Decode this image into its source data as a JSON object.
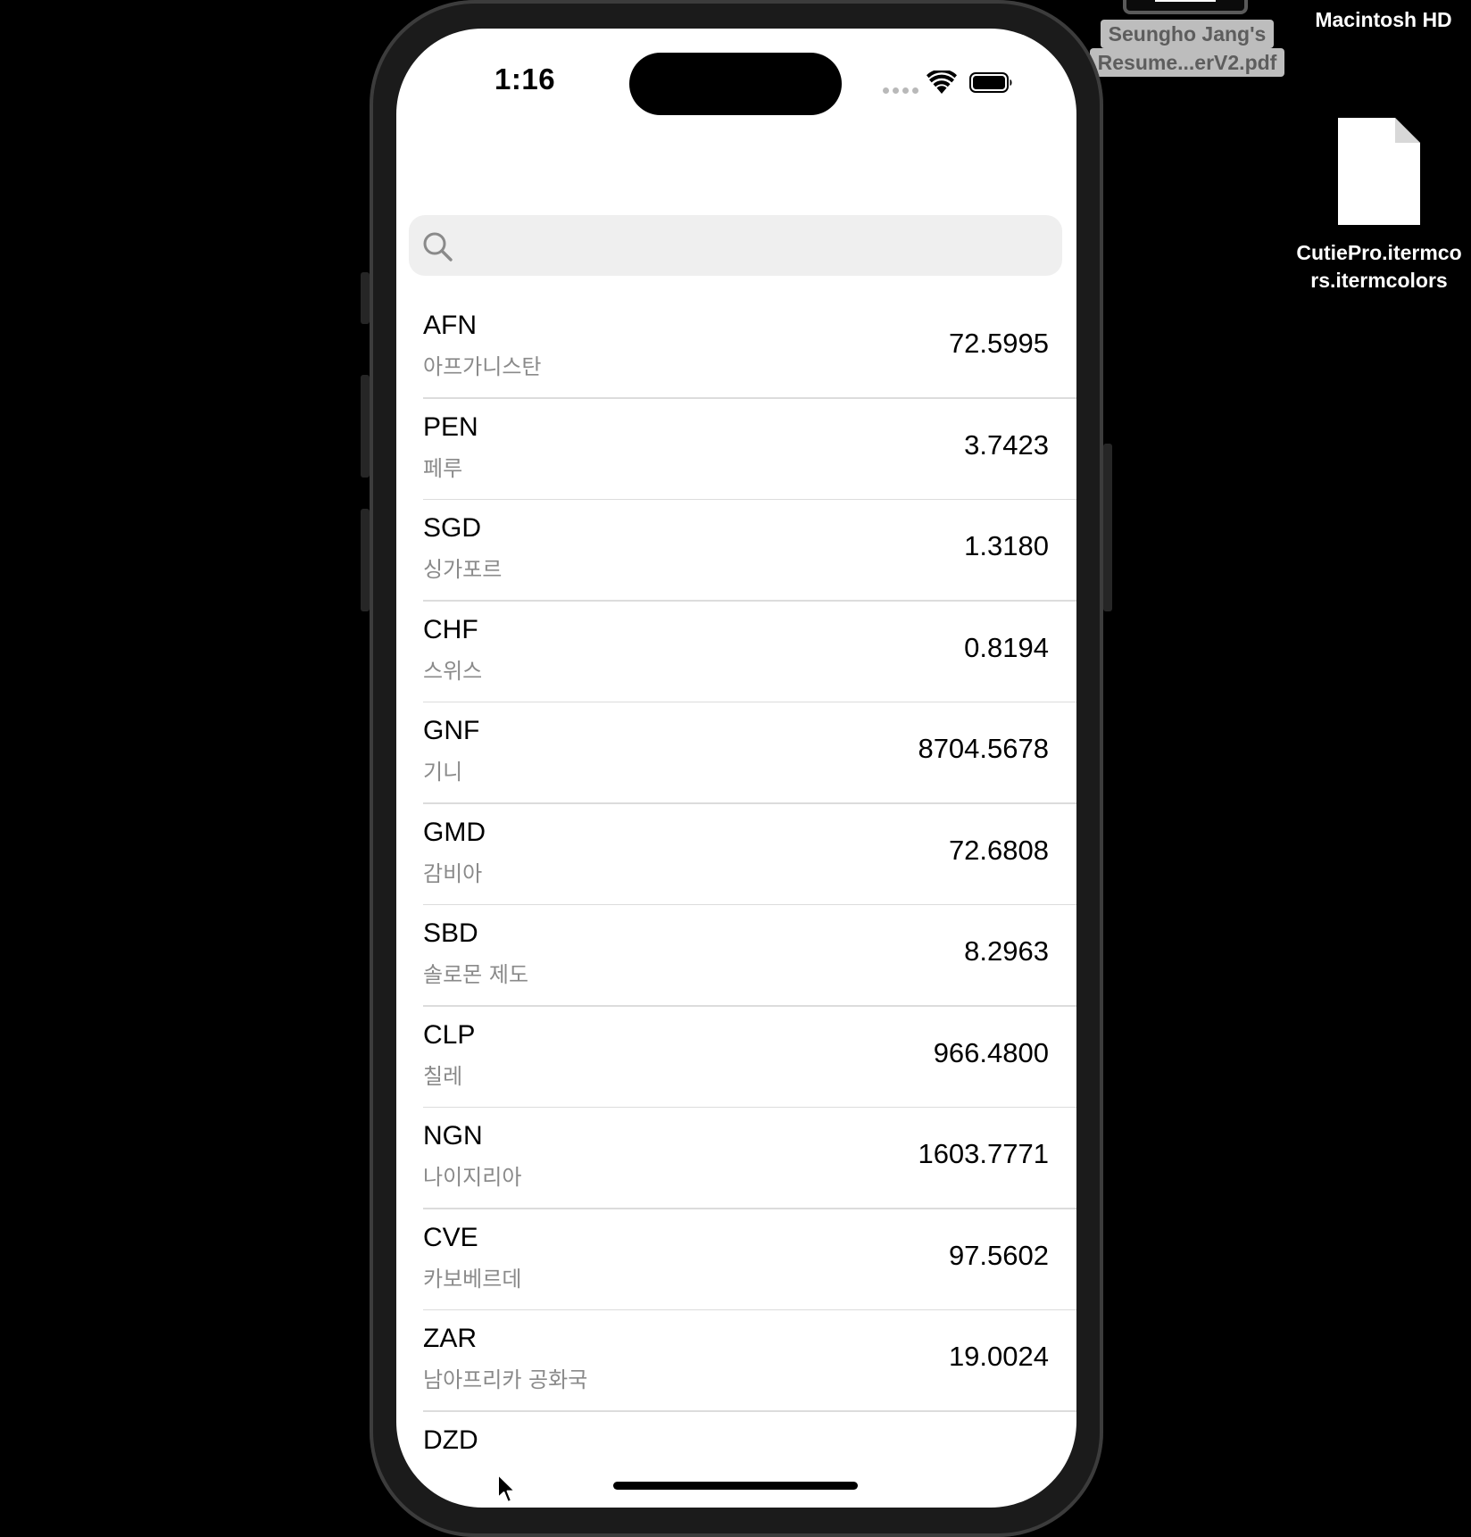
{
  "desktop": {
    "disk_label": "Macintosh HD",
    "pdf_label_line1": "Seungho Jang's",
    "pdf_label_line2": "Resume...erV2.pdf",
    "file_label_line1": "CutiePro.itermco",
    "file_label_line2": "rs.itermcolors"
  },
  "status_bar": {
    "time": "1:16"
  },
  "search": {
    "value": "",
    "placeholder": ""
  },
  "currencies": [
    {
      "code": "AFN",
      "country": "아프가니스탄",
      "rate": "72.5995"
    },
    {
      "code": "PEN",
      "country": "페루",
      "rate": "3.7423"
    },
    {
      "code": "SGD",
      "country": "싱가포르",
      "rate": "1.3180"
    },
    {
      "code": "CHF",
      "country": "스위스",
      "rate": "0.8194"
    },
    {
      "code": "GNF",
      "country": "기니",
      "rate": "8704.5678"
    },
    {
      "code": "GMD",
      "country": "감비아",
      "rate": "72.6808"
    },
    {
      "code": "SBD",
      "country": "솔로몬 제도",
      "rate": "8.2963"
    },
    {
      "code": "CLP",
      "country": "칠레",
      "rate": "966.4800"
    },
    {
      "code": "NGN",
      "country": "나이지리아",
      "rate": "1603.7771"
    },
    {
      "code": "CVE",
      "country": "카보베르데",
      "rate": "97.5602"
    },
    {
      "code": "ZAR",
      "country": "남아프리카 공화국",
      "rate": "19.0024"
    },
    {
      "code": "DZD",
      "country": "",
      "rate": ""
    }
  ]
}
